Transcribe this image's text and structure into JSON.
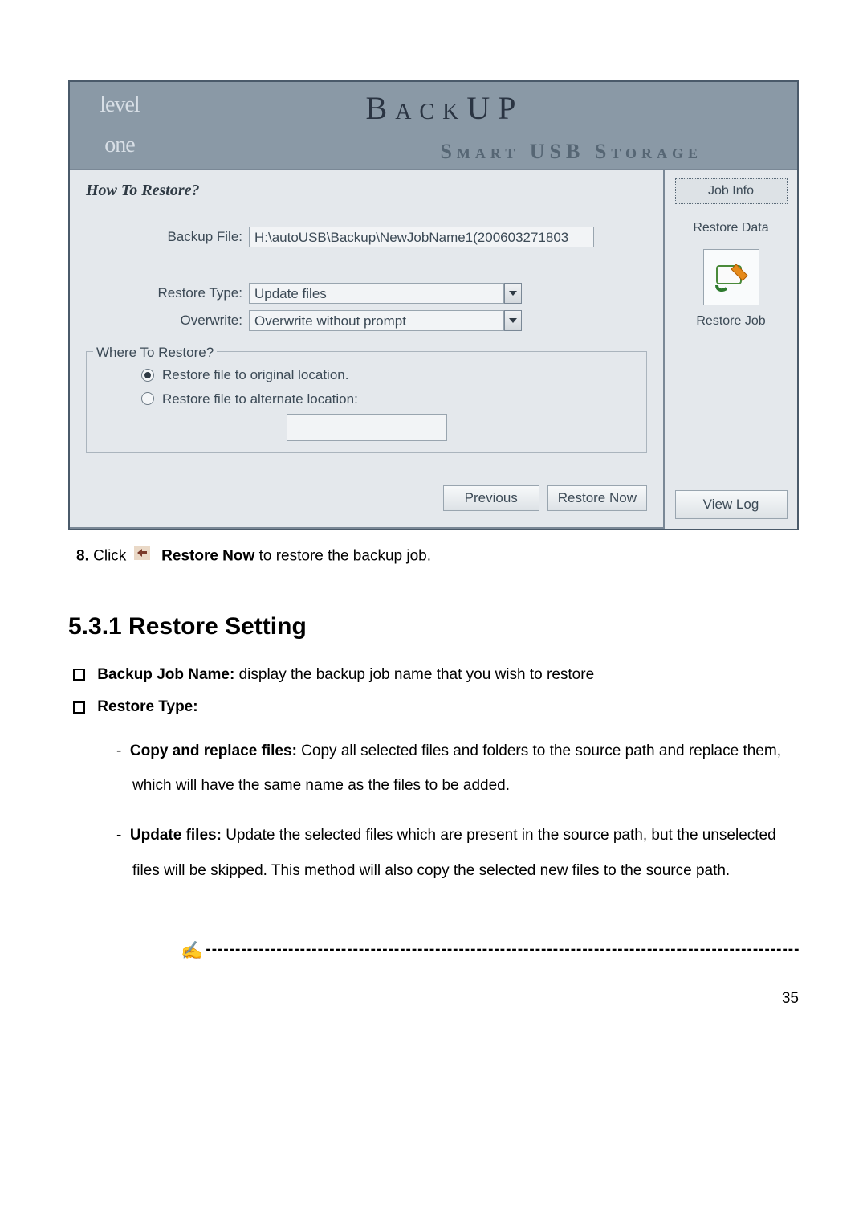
{
  "app": {
    "logo_top": "level",
    "logo_bottom": "one",
    "header_title1": "BackUP",
    "header_title2": "Smart USB Storage"
  },
  "main": {
    "heading": "How To Restore?",
    "backup_file_label": "Backup File:",
    "backup_file_value": "H:\\autoUSB\\Backup\\NewJobName1(200603271803",
    "restore_type_label": "Restore Type:",
    "restore_type_value": "Update files",
    "overwrite_label": "Overwrite:",
    "overwrite_value": "Overwrite without prompt",
    "where_legend": "Where To Restore?",
    "radio_original": "Restore file to original location.",
    "radio_alternate": "Restore file to alternate location:",
    "button_previous": "Previous",
    "button_restore_now": "Restore Now"
  },
  "side": {
    "job_info": "Job Info",
    "restore_data": "Restore Data",
    "restore_job": "Restore Job",
    "view_log": "View Log"
  },
  "doc": {
    "step8_prefix": "8.",
    "step8_click": "Click",
    "step8_bold": "Restore Now",
    "step8_rest": " to restore the backup job.",
    "section_heading": "5.3.1   Restore Setting",
    "bullet1_bold": "Backup Job Name:",
    "bullet1_rest": " display the backup job name that you wish to restore",
    "bullet2_bold": "Restore Type:",
    "dash1_bold": "Copy and replace files:",
    "dash1_rest": " Copy all selected files and folders to the source path and replace them, which will have the same name as the files to be added.",
    "dash2_bold": "Update files:",
    "dash2_rest": " Update the selected files which are present in the source path, but the unselected files will be skipped. This method will also copy the selected new files to the source path.",
    "page_number": "35",
    "dashes": "-------------------------------------------------------------------------------------------------------"
  }
}
